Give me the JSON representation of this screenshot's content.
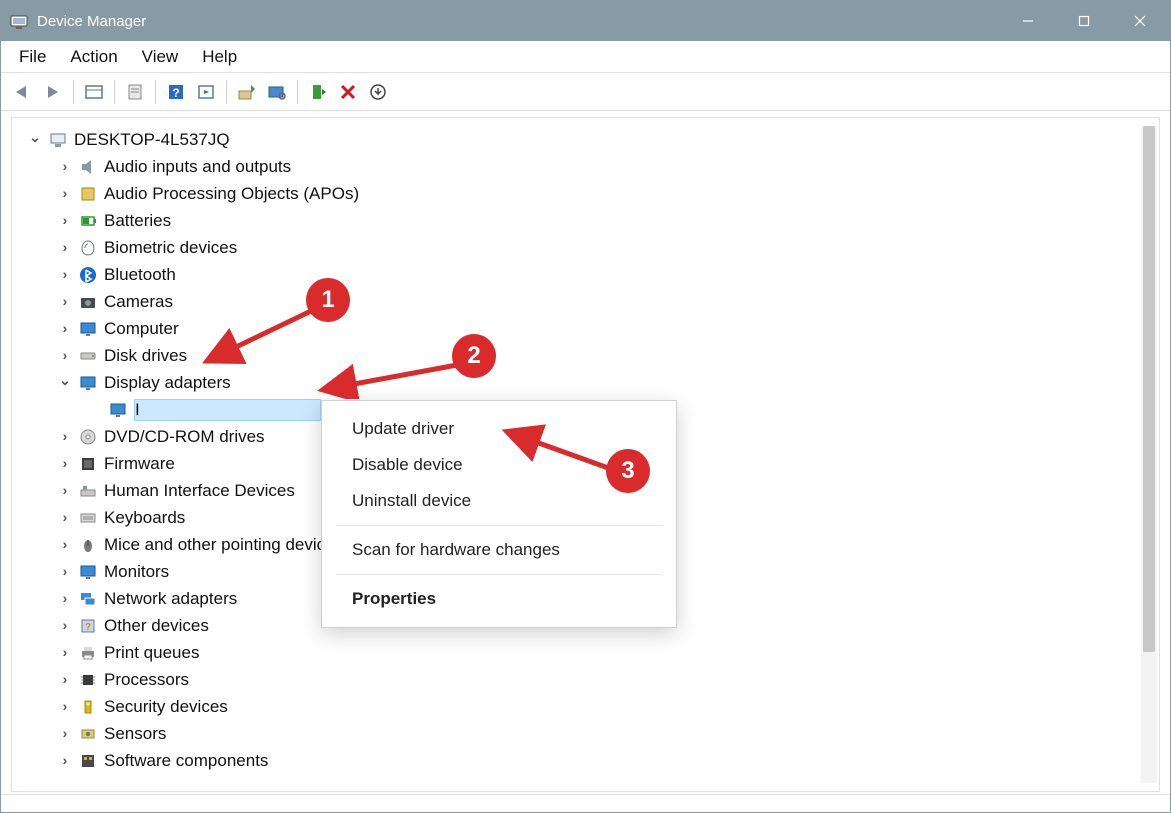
{
  "titlebar": {
    "title": "Device Manager"
  },
  "menubar": {
    "file": "File",
    "action": "Action",
    "view": "View",
    "help": "Help"
  },
  "tree": {
    "root": "DESKTOP-4L537JQ",
    "categories": [
      {
        "label": "Audio inputs and outputs",
        "expanded": false
      },
      {
        "label": "Audio Processing Objects (APOs)",
        "expanded": false
      },
      {
        "label": "Batteries",
        "expanded": false
      },
      {
        "label": "Biometric devices",
        "expanded": false
      },
      {
        "label": "Bluetooth",
        "expanded": false
      },
      {
        "label": "Cameras",
        "expanded": false
      },
      {
        "label": "Computer",
        "expanded": false
      },
      {
        "label": "Disk drives",
        "expanded": false
      },
      {
        "label": "Display adapters",
        "expanded": true,
        "child": "I"
      },
      {
        "label": "DVD/CD-ROM drives",
        "expanded": false
      },
      {
        "label": "Firmware",
        "expanded": false
      },
      {
        "label": "Human Interface Devices",
        "expanded": false
      },
      {
        "label": "Keyboards",
        "expanded": false
      },
      {
        "label": "Mice and other pointing devices",
        "expanded": false
      },
      {
        "label": "Monitors",
        "expanded": false
      },
      {
        "label": "Network adapters",
        "expanded": false
      },
      {
        "label": "Other devices",
        "expanded": false
      },
      {
        "label": "Print queues",
        "expanded": false
      },
      {
        "label": "Processors",
        "expanded": false
      },
      {
        "label": "Security devices",
        "expanded": false
      },
      {
        "label": "Sensors",
        "expanded": false
      },
      {
        "label": "Software components",
        "expanded": false
      }
    ]
  },
  "context_menu": {
    "update": "Update driver",
    "disable": "Disable device",
    "uninstall": "Uninstall device",
    "scan": "Scan for hardware changes",
    "properties": "Properties"
  },
  "callouts": {
    "1": "1",
    "2": "2",
    "3": "3"
  }
}
